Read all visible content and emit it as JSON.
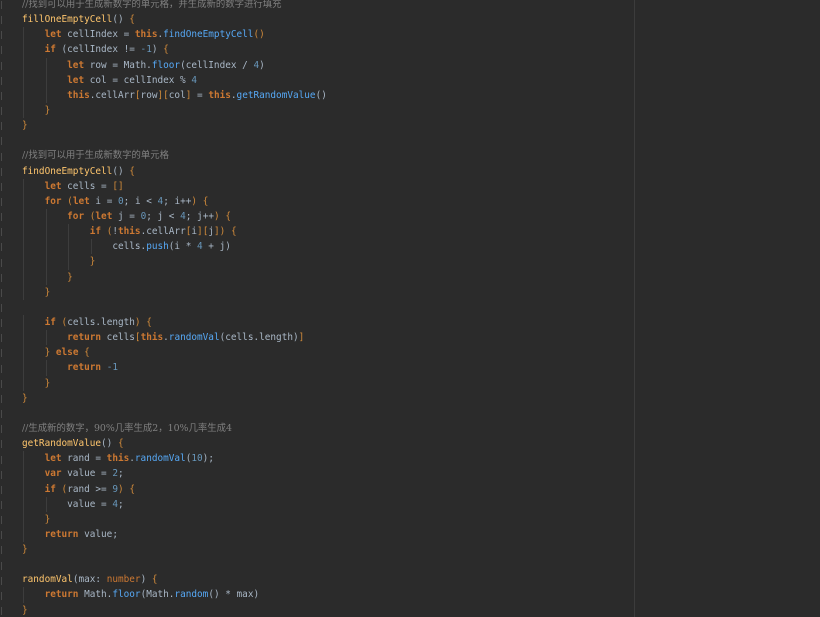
{
  "editor": {
    "lines": [
      [
        {
          "t": "//找到可以用于生成新数字的单元格，并生成新的数字进行填充",
          "c": "cmt"
        }
      ],
      [
        {
          "t": "fillOneEmptyCell",
          "c": "fn"
        },
        {
          "t": "() ",
          "c": ""
        },
        {
          "t": "{",
          "c": "bk"
        }
      ],
      [
        {
          "t": "    ",
          "c": ""
        },
        {
          "t": "let",
          "c": "kw"
        },
        {
          "t": " cellIndex = ",
          "c": ""
        },
        {
          "t": "this",
          "c": "kw"
        },
        {
          "t": ".",
          "c": ""
        },
        {
          "t": "findOneEmptyCell",
          "c": "call"
        },
        {
          "t": "()",
          "c": "bk"
        }
      ],
      [
        {
          "t": "    ",
          "c": ""
        },
        {
          "t": "if",
          "c": "kw"
        },
        {
          "t": " (cellIndex != ",
          "c": ""
        },
        {
          "t": "-1",
          "c": "num"
        },
        {
          "t": ") ",
          "c": ""
        },
        {
          "t": "{",
          "c": "bk"
        }
      ],
      [
        {
          "t": "        ",
          "c": ""
        },
        {
          "t": "let",
          "c": "kw"
        },
        {
          "t": " row = Math.",
          "c": ""
        },
        {
          "t": "floor",
          "c": "call"
        },
        {
          "t": "(cellIndex / ",
          "c": ""
        },
        {
          "t": "4",
          "c": "num"
        },
        {
          "t": ")",
          "c": ""
        }
      ],
      [
        {
          "t": "        ",
          "c": ""
        },
        {
          "t": "let",
          "c": "kw"
        },
        {
          "t": " col = cellIndex % ",
          "c": ""
        },
        {
          "t": "4",
          "c": "num"
        }
      ],
      [
        {
          "t": "        ",
          "c": ""
        },
        {
          "t": "this",
          "c": "kw"
        },
        {
          "t": ".cellArr",
          "c": ""
        },
        {
          "t": "[",
          "c": "bk"
        },
        {
          "t": "row",
          "c": ""
        },
        {
          "t": "][",
          "c": "bk"
        },
        {
          "t": "col",
          "c": ""
        },
        {
          "t": "]",
          "c": "bk"
        },
        {
          "t": " = ",
          "c": ""
        },
        {
          "t": "this",
          "c": "kw"
        },
        {
          "t": ".",
          "c": ""
        },
        {
          "t": "getRandomValue",
          "c": "call"
        },
        {
          "t": "()",
          "c": ""
        }
      ],
      [
        {
          "t": "    ",
          "c": ""
        },
        {
          "t": "}",
          "c": "bk"
        }
      ],
      [
        {
          "t": "}",
          "c": "bk"
        }
      ],
      [],
      [
        {
          "t": "//找到可以用于生成新数字的单元格",
          "c": "cmt"
        }
      ],
      [
        {
          "t": "findOneEmptyCell",
          "c": "fn"
        },
        {
          "t": "() ",
          "c": ""
        },
        {
          "t": "{",
          "c": "bk"
        }
      ],
      [
        {
          "t": "    ",
          "c": ""
        },
        {
          "t": "let",
          "c": "kw"
        },
        {
          "t": " cells = ",
          "c": ""
        },
        {
          "t": "[]",
          "c": "bk"
        }
      ],
      [
        {
          "t": "    ",
          "c": ""
        },
        {
          "t": "for",
          "c": "kw"
        },
        {
          "t": " ",
          "c": ""
        },
        {
          "t": "(",
          "c": "bk"
        },
        {
          "t": "let",
          "c": "kw"
        },
        {
          "t": " i = ",
          "c": ""
        },
        {
          "t": "0",
          "c": "num"
        },
        {
          "t": "; i < ",
          "c": ""
        },
        {
          "t": "4",
          "c": "num"
        },
        {
          "t": "; i++",
          "c": ""
        },
        {
          "t": ")",
          "c": "bk"
        },
        {
          "t": " ",
          "c": ""
        },
        {
          "t": "{",
          "c": "bk"
        }
      ],
      [
        {
          "t": "        ",
          "c": ""
        },
        {
          "t": "for",
          "c": "kw"
        },
        {
          "t": " ",
          "c": ""
        },
        {
          "t": "(",
          "c": "bk"
        },
        {
          "t": "let",
          "c": "kw"
        },
        {
          "t": " j = ",
          "c": ""
        },
        {
          "t": "0",
          "c": "num"
        },
        {
          "t": "; j < ",
          "c": ""
        },
        {
          "t": "4",
          "c": "num"
        },
        {
          "t": "; j++",
          "c": ""
        },
        {
          "t": ")",
          "c": "bk"
        },
        {
          "t": " ",
          "c": ""
        },
        {
          "t": "{",
          "c": "bk"
        }
      ],
      [
        {
          "t": "            ",
          "c": ""
        },
        {
          "t": "if",
          "c": "kw"
        },
        {
          "t": " ",
          "c": ""
        },
        {
          "t": "(",
          "c": "bk"
        },
        {
          "t": "!",
          "c": ""
        },
        {
          "t": "this",
          "c": "kw"
        },
        {
          "t": ".cellArr",
          "c": ""
        },
        {
          "t": "[",
          "c": "bk"
        },
        {
          "t": "i",
          "c": ""
        },
        {
          "t": "][",
          "c": "bk"
        },
        {
          "t": "j",
          "c": ""
        },
        {
          "t": "]",
          "c": "bk"
        },
        {
          "t": ")",
          "c": "bk"
        },
        {
          "t": " ",
          "c": ""
        },
        {
          "t": "{",
          "c": "bk"
        }
      ],
      [
        {
          "t": "                ",
          "c": ""
        },
        {
          "t": "cells.",
          "c": ""
        },
        {
          "t": "push",
          "c": "call"
        },
        {
          "t": "(i * ",
          "c": ""
        },
        {
          "t": "4",
          "c": "num"
        },
        {
          "t": " + j)",
          "c": ""
        }
      ],
      [
        {
          "t": "            ",
          "c": ""
        },
        {
          "t": "}",
          "c": "bk"
        }
      ],
      [
        {
          "t": "        ",
          "c": ""
        },
        {
          "t": "}",
          "c": "bk"
        }
      ],
      [
        {
          "t": "    ",
          "c": ""
        },
        {
          "t": "}",
          "c": "bk"
        }
      ],
      [],
      [
        {
          "t": "    ",
          "c": ""
        },
        {
          "t": "if",
          "c": "kw"
        },
        {
          "t": " ",
          "c": ""
        },
        {
          "t": "(",
          "c": "bk"
        },
        {
          "t": "cells.length",
          "c": ""
        },
        {
          "t": ")",
          "c": "bk"
        },
        {
          "t": " ",
          "c": ""
        },
        {
          "t": "{",
          "c": "bk"
        }
      ],
      [
        {
          "t": "        ",
          "c": ""
        },
        {
          "t": "return",
          "c": "kw"
        },
        {
          "t": " cells",
          "c": ""
        },
        {
          "t": "[",
          "c": "bk"
        },
        {
          "t": "this",
          "c": "kw"
        },
        {
          "t": ".",
          "c": ""
        },
        {
          "t": "randomVal",
          "c": "call"
        },
        {
          "t": "(cells.length)",
          "c": ""
        },
        {
          "t": "]",
          "c": "bk"
        }
      ],
      [
        {
          "t": "    ",
          "c": ""
        },
        {
          "t": "}",
          "c": "bk"
        },
        {
          "t": " ",
          "c": ""
        },
        {
          "t": "else",
          "c": "kw"
        },
        {
          "t": " ",
          "c": ""
        },
        {
          "t": "{",
          "c": "bk"
        }
      ],
      [
        {
          "t": "        ",
          "c": ""
        },
        {
          "t": "return",
          "c": "kw"
        },
        {
          "t": " ",
          "c": ""
        },
        {
          "t": "-1",
          "c": "num"
        }
      ],
      [
        {
          "t": "    ",
          "c": ""
        },
        {
          "t": "}",
          "c": "bk"
        }
      ],
      [
        {
          "t": "}",
          "c": "bk"
        }
      ],
      [],
      [
        {
          "t": "//生成新的数字，90%几率生成2，10%几率生成4",
          "c": "cmt"
        }
      ],
      [
        {
          "t": "getRandomValue",
          "c": "fn"
        },
        {
          "t": "() ",
          "c": ""
        },
        {
          "t": "{",
          "c": "bk"
        }
      ],
      [
        {
          "t": "    ",
          "c": ""
        },
        {
          "t": "let",
          "c": "kw"
        },
        {
          "t": " rand = ",
          "c": ""
        },
        {
          "t": "this",
          "c": "kw"
        },
        {
          "t": ".",
          "c": ""
        },
        {
          "t": "randomVal",
          "c": "call"
        },
        {
          "t": "(",
          "c": ""
        },
        {
          "t": "10",
          "c": "num"
        },
        {
          "t": ");",
          "c": ""
        }
      ],
      [
        {
          "t": "    ",
          "c": ""
        },
        {
          "t": "var",
          "c": "kw"
        },
        {
          "t": " value = ",
          "c": ""
        },
        {
          "t": "2",
          "c": "num"
        },
        {
          "t": ";",
          "c": ""
        }
      ],
      [
        {
          "t": "    ",
          "c": ""
        },
        {
          "t": "if",
          "c": "kw"
        },
        {
          "t": " ",
          "c": ""
        },
        {
          "t": "(",
          "c": "bk"
        },
        {
          "t": "rand >= ",
          "c": ""
        },
        {
          "t": "9",
          "c": "num"
        },
        {
          "t": ")",
          "c": "bk"
        },
        {
          "t": " ",
          "c": ""
        },
        {
          "t": "{",
          "c": "bk"
        }
      ],
      [
        {
          "t": "        ",
          "c": ""
        },
        {
          "t": "value = ",
          "c": ""
        },
        {
          "t": "4",
          "c": "num"
        },
        {
          "t": ";",
          "c": ""
        }
      ],
      [
        {
          "t": "    ",
          "c": ""
        },
        {
          "t": "}",
          "c": "bk"
        }
      ],
      [
        {
          "t": "    ",
          "c": ""
        },
        {
          "t": "return",
          "c": "kw"
        },
        {
          "t": " value;",
          "c": ""
        }
      ],
      [
        {
          "t": "}",
          "c": "bk"
        }
      ],
      [],
      [
        {
          "t": "randomVal",
          "c": "fn"
        },
        {
          "t": "(max: ",
          "c": ""
        },
        {
          "t": "number",
          "c": "ty"
        },
        {
          "t": ") ",
          "c": ""
        },
        {
          "t": "{",
          "c": "bk"
        }
      ],
      [
        {
          "t": "    ",
          "c": ""
        },
        {
          "t": "return",
          "c": "kw"
        },
        {
          "t": " Math.",
          "c": ""
        },
        {
          "t": "floor",
          "c": "call"
        },
        {
          "t": "(Math.",
          "c": ""
        },
        {
          "t": "random",
          "c": "call"
        },
        {
          "t": "() * max)",
          "c": ""
        }
      ],
      [
        {
          "t": "}",
          "c": "bk"
        }
      ]
    ]
  }
}
